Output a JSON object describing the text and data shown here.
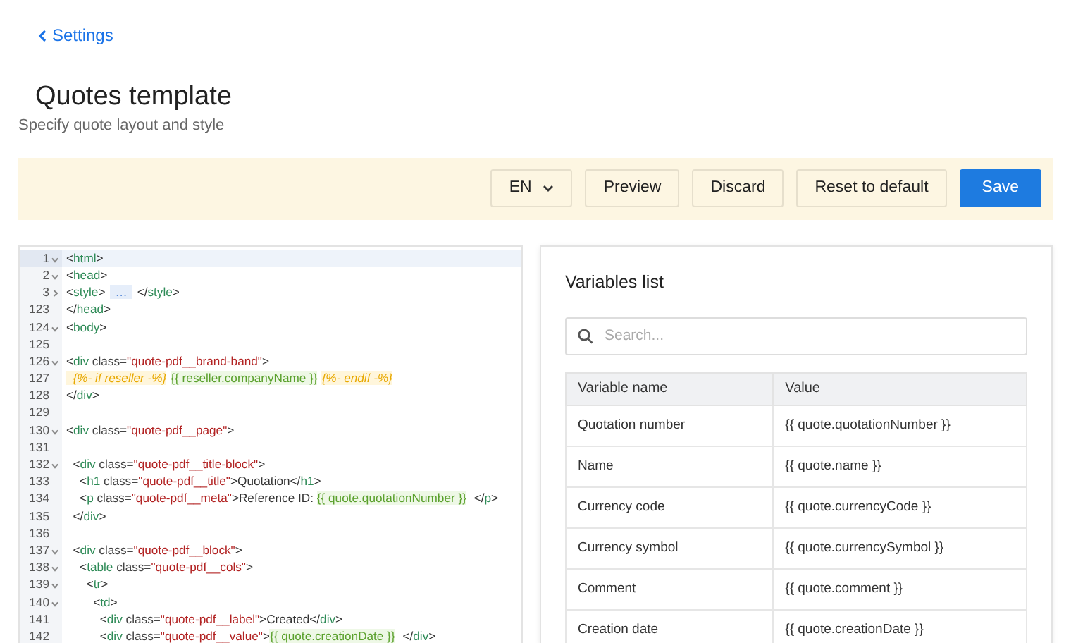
{
  "back_link": {
    "label": "Settings"
  },
  "page": {
    "title": "Quotes template",
    "subtitle": "Specify quote layout and style"
  },
  "toolbar": {
    "language": "EN",
    "buttons": [
      {
        "label": "Preview",
        "kind": "plain"
      },
      {
        "label": "Discard",
        "kind": "plain"
      },
      {
        "label": "Reset to default",
        "kind": "plain"
      },
      {
        "label": "Save",
        "kind": "primary"
      }
    ]
  },
  "editor": {
    "lines": [
      {
        "number": "1",
        "expanded": true,
        "selected": true,
        "tokens": [
          {
            "text": "<",
            "kind": "punct"
          },
          {
            "text": "html",
            "kind": "tag"
          },
          {
            "text": ">",
            "kind": "punct"
          }
        ]
      },
      {
        "number": "2",
        "expanded": true,
        "selected": false,
        "tokens": [
          {
            "text": "<",
            "kind": "punct"
          },
          {
            "text": "head",
            "kind": "tag"
          },
          {
            "text": ">",
            "kind": "punct"
          }
        ]
      },
      {
        "number": "3",
        "expanded": false,
        "selected": false,
        "tokens": [
          {
            "text": "<",
            "kind": "punct"
          },
          {
            "text": "style",
            "kind": "tag"
          },
          {
            "text": ">",
            "kind": "punct"
          },
          {
            "text": "…",
            "kind": "fold"
          },
          {
            "text": "</",
            "kind": "punct"
          },
          {
            "text": "style",
            "kind": "tag"
          },
          {
            "text": ">",
            "kind": "punct"
          }
        ]
      },
      {
        "number": "123",
        "selected": false,
        "tokens": [
          {
            "text": "</",
            "kind": "punct"
          },
          {
            "text": "head",
            "kind": "tag"
          },
          {
            "text": ">",
            "kind": "punct"
          }
        ]
      },
      {
        "number": "124",
        "expanded": true,
        "selected": false,
        "tokens": [
          {
            "text": "<",
            "kind": "punct"
          },
          {
            "text": "body",
            "kind": "tag"
          },
          {
            "text": ">",
            "kind": "punct"
          }
        ]
      },
      {
        "number": "125",
        "selected": false
      },
      {
        "number": "126",
        "expanded": true,
        "selected": false,
        "tokens": [
          {
            "text": "<",
            "kind": "punct"
          },
          {
            "text": "div",
            "kind": "tag"
          },
          {
            "text": " class=",
            "kind": "attr"
          },
          {
            "text": "\"quote-pdf__brand-band\"",
            "kind": "string"
          },
          {
            "text": ">",
            "kind": "punct"
          }
        ]
      },
      {
        "number": "127",
        "selected": false,
        "tokens": [
          {
            "text": "  {%- if reseller -%}",
            "kind": "template"
          },
          {
            "text": "{{ reseller.companyName }}",
            "kind": "variable"
          },
          {
            "text": "{%- endif -%}",
            "kind": "template"
          }
        ]
      },
      {
        "number": "128",
        "selected": false,
        "tokens": [
          {
            "text": "</",
            "kind": "punct"
          },
          {
            "text": "div",
            "kind": "tag"
          },
          {
            "text": ">",
            "kind": "punct"
          }
        ]
      },
      {
        "number": "129",
        "selected": false
      },
      {
        "number": "130",
        "expanded": true,
        "selected": false,
        "tokens": [
          {
            "text": "<",
            "kind": "punct"
          },
          {
            "text": "div",
            "kind": "tag"
          },
          {
            "text": " class=",
            "kind": "attr"
          },
          {
            "text": "\"quote-pdf__page\"",
            "kind": "string"
          },
          {
            "text": ">",
            "kind": "punct"
          }
        ]
      },
      {
        "number": "131",
        "selected": false
      },
      {
        "number": "132",
        "expanded": true,
        "selected": false,
        "tokens": [
          {
            "text": "  <",
            "kind": "punct"
          },
          {
            "text": "div",
            "kind": "tag"
          },
          {
            "text": " class=",
            "kind": "attr"
          },
          {
            "text": "\"quote-pdf__title-block\"",
            "kind": "string"
          },
          {
            "text": ">",
            "kind": "punct"
          }
        ]
      },
      {
        "number": "133",
        "selected": false,
        "tokens": [
          {
            "text": "    <",
            "kind": "punct"
          },
          {
            "text": "h1",
            "kind": "tag"
          },
          {
            "text": " class=",
            "kind": "attr"
          },
          {
            "text": "\"quote-pdf__title\"",
            "kind": "string"
          },
          {
            "text": ">Quotation</",
            "kind": "punct"
          },
          {
            "text": "h1",
            "kind": "tag"
          },
          {
            "text": ">",
            "kind": "punct"
          }
        ]
      },
      {
        "number": "134",
        "selected": false,
        "tokens": [
          {
            "text": "    <",
            "kind": "punct"
          },
          {
            "text": "p",
            "kind": "tag"
          },
          {
            "text": " class=",
            "kind": "attr"
          },
          {
            "text": "\"quote-pdf__meta\"",
            "kind": "string"
          },
          {
            "text": ">Reference ID: ",
            "kind": "punct"
          },
          {
            "text": "{{ quote.quotationNumber }}",
            "kind": "variable"
          },
          {
            "text": " </",
            "kind": "punct"
          },
          {
            "text": "p",
            "kind": "tag"
          },
          {
            "text": ">",
            "kind": "punct"
          }
        ]
      },
      {
        "number": "135",
        "selected": false,
        "tokens": [
          {
            "text": "  </",
            "kind": "punct"
          },
          {
            "text": "div",
            "kind": "tag"
          },
          {
            "text": ">",
            "kind": "punct"
          }
        ]
      },
      {
        "number": "136",
        "selected": false
      },
      {
        "number": "137",
        "expanded": true,
        "selected": false,
        "tokens": [
          {
            "text": "  <",
            "kind": "punct"
          },
          {
            "text": "div",
            "kind": "tag"
          },
          {
            "text": " class=",
            "kind": "attr"
          },
          {
            "text": "\"quote-pdf__block\"",
            "kind": "string"
          },
          {
            "text": ">",
            "kind": "punct"
          }
        ]
      },
      {
        "number": "138",
        "expanded": true,
        "selected": false,
        "tokens": [
          {
            "text": "    <",
            "kind": "punct"
          },
          {
            "text": "table",
            "kind": "tag"
          },
          {
            "text": " class=",
            "kind": "attr"
          },
          {
            "text": "\"quote-pdf__cols\"",
            "kind": "string"
          },
          {
            "text": ">",
            "kind": "punct"
          }
        ]
      },
      {
        "number": "139",
        "expanded": true,
        "selected": false,
        "tokens": [
          {
            "text": "      <",
            "kind": "punct"
          },
          {
            "text": "tr",
            "kind": "tag"
          },
          {
            "text": ">",
            "kind": "punct"
          }
        ]
      },
      {
        "number": "140",
        "expanded": true,
        "selected": false,
        "tokens": [
          {
            "text": "        <",
            "kind": "punct"
          },
          {
            "text": "td",
            "kind": "tag"
          },
          {
            "text": ">",
            "kind": "punct"
          }
        ]
      },
      {
        "number": "141",
        "selected": false,
        "tokens": [
          {
            "text": "          <",
            "kind": "punct"
          },
          {
            "text": "div",
            "kind": "tag"
          },
          {
            "text": " class=",
            "kind": "attr"
          },
          {
            "text": "\"quote-pdf__label\"",
            "kind": "string"
          },
          {
            "text": ">Created</",
            "kind": "punct"
          },
          {
            "text": "div",
            "kind": "tag"
          },
          {
            "text": ">",
            "kind": "punct"
          }
        ]
      },
      {
        "number": "142",
        "selected": false,
        "tokens": [
          {
            "text": "          <",
            "kind": "punct"
          },
          {
            "text": "div",
            "kind": "tag"
          },
          {
            "text": " class=",
            "kind": "attr"
          },
          {
            "text": "\"quote-pdf__value\"",
            "kind": "string"
          },
          {
            "text": ">",
            "kind": "punct"
          },
          {
            "text": "{{ quote.creationDate }}",
            "kind": "variable"
          },
          {
            "text": " </",
            "kind": "punct"
          },
          {
            "text": "div",
            "kind": "tag"
          },
          {
            "text": ">",
            "kind": "punct"
          }
        ]
      }
    ]
  },
  "variables": {
    "title": "Variables list",
    "search": {
      "placeholder": "Search..."
    },
    "columns": [
      "Variable name",
      "Value"
    ],
    "rows": [
      [
        "Quotation number",
        "{{ quote.quotationNumber }}"
      ],
      [
        "Name",
        "{{ quote.name }}"
      ],
      [
        "Currency code",
        "{{ quote.currencyCode }}"
      ],
      [
        "Currency symbol",
        "{{ quote.currencySymbol }}"
      ],
      [
        "Comment",
        "{{ quote.comment }}"
      ],
      [
        "Creation date",
        "{{ quote.creationDate }}"
      ]
    ]
  }
}
